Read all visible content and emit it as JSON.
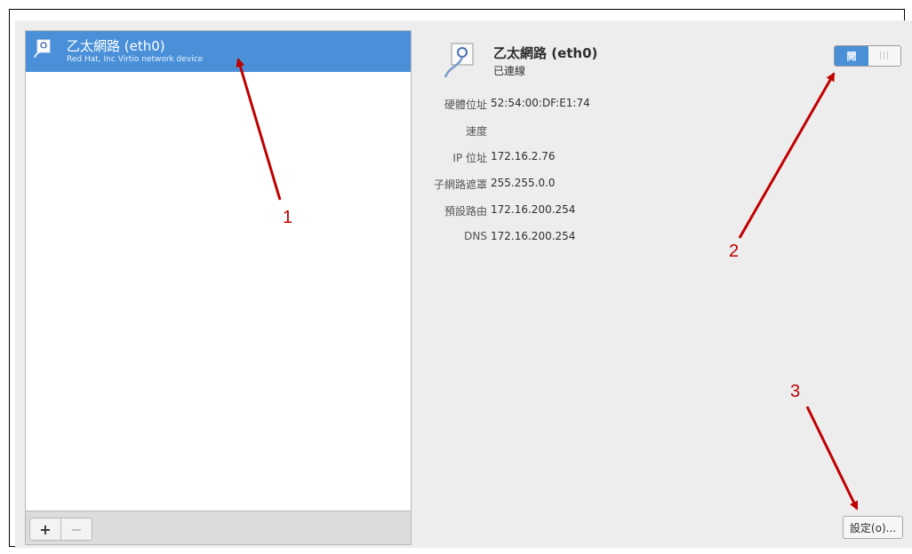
{
  "connections": {
    "item": {
      "name": "乙太網路 (eth0)",
      "description": "Red Hat, Inc Virtio network device"
    },
    "toolbar": {
      "add_label": "+",
      "remove_label": "−"
    }
  },
  "detail": {
    "title": "乙太網路 (eth0)",
    "status": "已連線",
    "rows": [
      {
        "label": "硬體位址",
        "value": "52:54:00:DF:E1:74"
      },
      {
        "label": "速度",
        "value": ""
      },
      {
        "label": "IP 位址",
        "value": "172.16.2.76"
      },
      {
        "label": "子網路遮罩",
        "value": "255.255.0.0"
      },
      {
        "label": "預設路由",
        "value": "172.16.200.254"
      },
      {
        "label": "DNS",
        "value": "172.16.200.254"
      }
    ],
    "toggle": {
      "on_label": "開",
      "state": "on"
    },
    "settings_label": "設定(o)..."
  },
  "annotations": {
    "one": "1",
    "two": "2",
    "three": "3"
  },
  "colors": {
    "accent": "#4a90d9",
    "annotation": "#c00000"
  }
}
